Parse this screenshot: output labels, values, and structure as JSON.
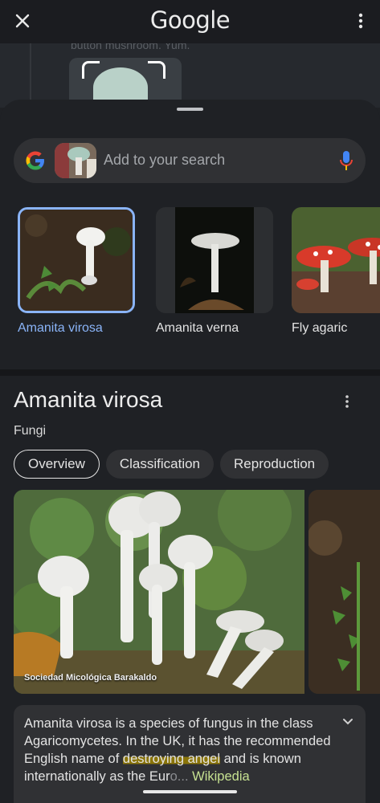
{
  "topbar": {
    "title": "Google",
    "close_icon": "close-icon",
    "more_icon": "more-vert-icon"
  },
  "background": {
    "partial_text": "button mushroom. Yum."
  },
  "search": {
    "placeholder": "Add to your search",
    "logo": "google-g-icon",
    "mic_icon": "mic-icon"
  },
  "matches": [
    {
      "label": "Amanita virosa",
      "selected": true
    },
    {
      "label": "Amanita verna",
      "selected": false
    },
    {
      "label": "Fly agaric",
      "selected": false
    }
  ],
  "panel": {
    "title": "Amanita virosa",
    "subtitle": "Fungi",
    "chips": [
      "Overview",
      "Classification",
      "Reproduction"
    ],
    "active_chip": "Overview",
    "photo_credit": "Sociedad Micológica Barakaldo",
    "description": {
      "part1": "Amanita virosa is a species of fungus in the class Agaricomycetes. In the UK, it has the recommended English name of ",
      "highlight": "destroying angel",
      "part2": " and is known internationally as the Eur",
      "faded": "o...",
      "source": "Wikipedia"
    }
  },
  "colors": {
    "accent": "#8ab4f8",
    "highlight": "#8a7409",
    "wiki": "#c6e191",
    "surface": "#303134"
  }
}
